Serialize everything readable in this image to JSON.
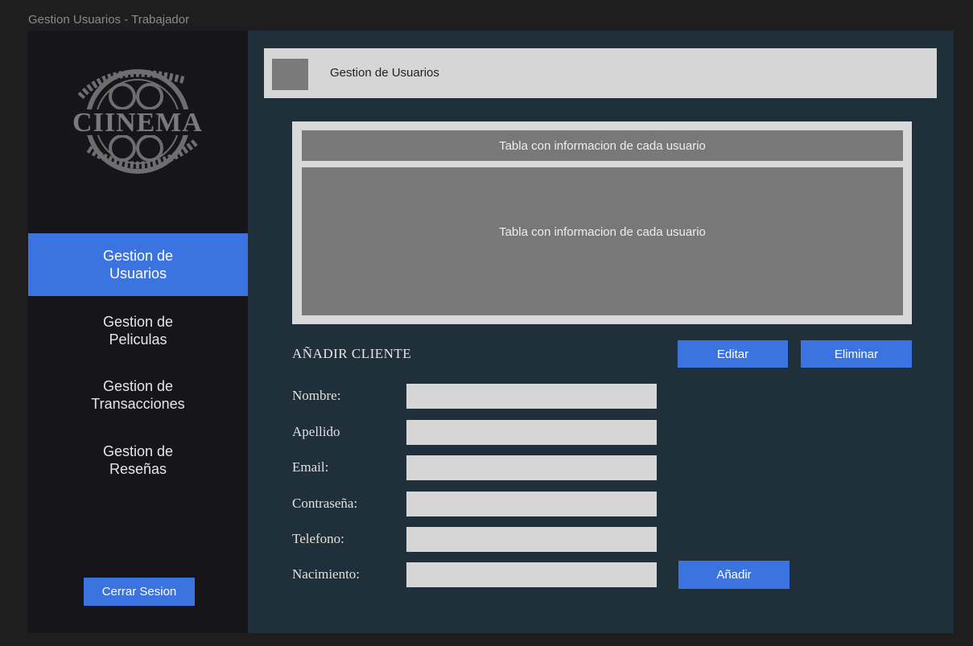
{
  "window": {
    "title": "Gestion Usuarios - Trabajador"
  },
  "sidebar": {
    "logo_text": "CIINEMA",
    "items": [
      {
        "label": "Gestion de\nUsuarios",
        "active": true
      },
      {
        "label": "Gestion de\nPeliculas",
        "active": false
      },
      {
        "label": "Gestion de\nTransacciones",
        "active": false
      },
      {
        "label": "Gestion de\nReseñas",
        "active": false
      }
    ],
    "logout_label": "Cerrar Sesion"
  },
  "header": {
    "title": "Gestion de Usuarios"
  },
  "table": {
    "header_text": "Tabla con informacion de cada usuario",
    "body_text": "Tabla con informacion de cada usuario"
  },
  "form": {
    "title": "AÑADIR CLIENTE",
    "edit_label": "Editar",
    "delete_label": "Eliminar",
    "add_label": "Añadir",
    "fields": [
      {
        "label": "Nombre:",
        "value": ""
      },
      {
        "label": "Apellido",
        "value": ""
      },
      {
        "label": "Email:",
        "value": ""
      },
      {
        "label": "Contraseña:",
        "value": ""
      },
      {
        "label": "Telefono:",
        "value": ""
      },
      {
        "label": "Nacimiento:",
        "value": ""
      }
    ]
  },
  "colors": {
    "accent": "#3b73e0",
    "sidebar_bg": "#16161a",
    "main_bg": "#1f303b",
    "panel_gray": "#787878",
    "light_gray": "#d6d6d6"
  }
}
